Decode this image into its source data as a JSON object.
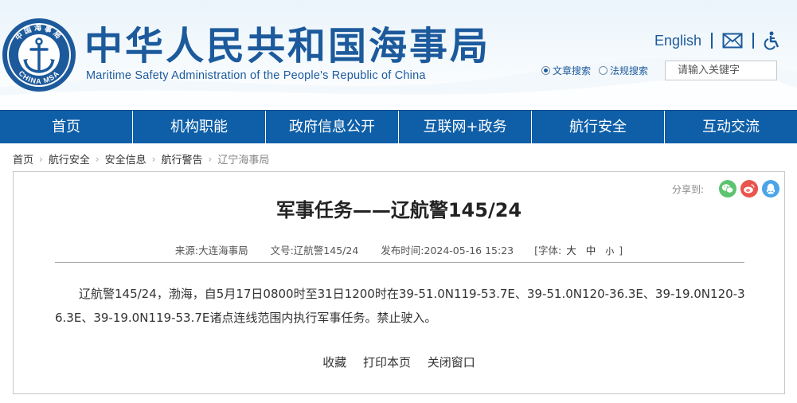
{
  "header": {
    "logo_top_text": "中国海事局",
    "logo_bottom_text": "CHINA MSA",
    "title_cn": "中华人民共和国海事局",
    "title_en": "Maritime Safety Administration of the People's Republic of China",
    "english_link": "English",
    "icons": [
      "mail-icon",
      "accessibility-icon"
    ]
  },
  "search": {
    "options": [
      "文章搜索",
      "法规搜索"
    ],
    "selected": "文章搜索",
    "placeholder": "请输入关键字"
  },
  "nav": {
    "items": [
      "首页",
      "机构职能",
      "政府信息公开",
      "互联网+政务",
      "航行安全",
      "互动交流"
    ]
  },
  "breadcrumb": [
    "首页",
    "航行安全",
    "安全信息",
    "航行警告",
    "辽宁海事局"
  ],
  "share": {
    "label": "分享到:",
    "targets": [
      "wechat-icon",
      "weibo-icon",
      "qq-icon"
    ],
    "colors": {
      "wechat": "#5cc46e",
      "weibo": "#e9544d",
      "qq": "#4aa4e8"
    }
  },
  "article": {
    "title": "军事任务——辽航警145/24",
    "source_label": "来源:",
    "source": "大连海事局",
    "doc_no_label": "文号:",
    "doc_no": "辽航警145/24",
    "publish_label": "发布时间:",
    "publish_time": "2024-05-16 15:23",
    "font_label": "[字体:",
    "font_sizes": [
      "大",
      "中",
      "小"
    ],
    "font_close": "]",
    "body": "辽航警145/24，渤海，自5月17日0800时至31日1200时在39-51.0N119-53.7E、39-51.0N120-36.3E、39-19.0N120-36.3E、39-19.0N119-53.7E诸点连线范围内执行军事任务。禁止驶入。"
  },
  "actions": [
    "收藏",
    "打印本页",
    "关闭窗口"
  ],
  "colors": {
    "brand_blue": "#1c5a9c",
    "nav_blue": "#0f5fa8"
  }
}
